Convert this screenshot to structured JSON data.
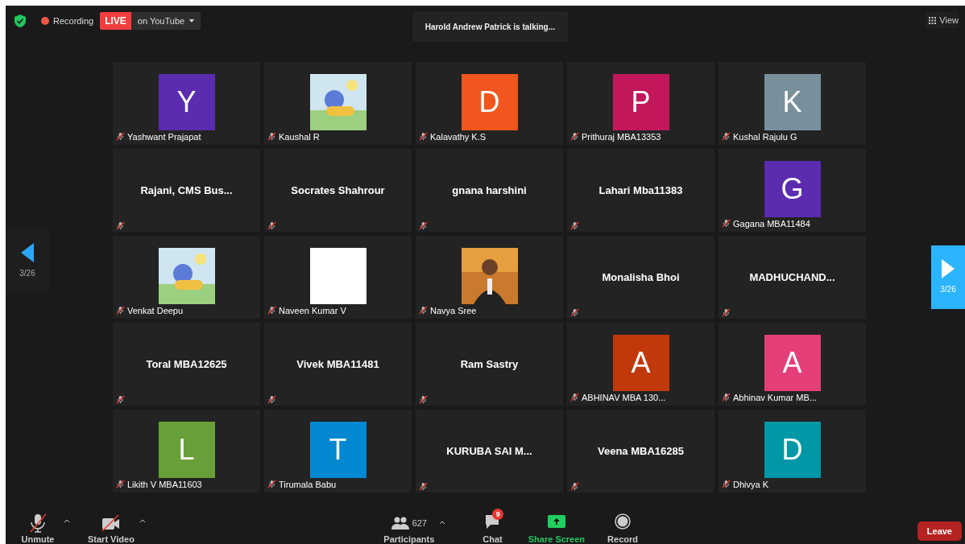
{
  "top_bar": {
    "recording_label": "Recording",
    "live_badge": "LIVE",
    "stream_target": "on YouTube",
    "talking": "Harold Andrew Patrick is talking...",
    "view_button": "View"
  },
  "pager": {
    "left": "3/26",
    "right": "3/26"
  },
  "tiles": [
    {
      "kind": "avatar",
      "letter": "Y",
      "color": "#5b2bb0",
      "name": "Yashwant Prajapat"
    },
    {
      "kind": "picture",
      "name": "Kaushal R"
    },
    {
      "kind": "avatar",
      "letter": "D",
      "color": "#f0561d",
      "name": "Kalavathy K.S"
    },
    {
      "kind": "avatar",
      "letter": "P",
      "color": "#c2185b",
      "name": "Prithuraj MBA13353"
    },
    {
      "kind": "avatar",
      "letter": "K",
      "color": "#78909c",
      "name": "Kushal Rajulu G"
    },
    {
      "kind": "label",
      "title": "Rajani,  CMS Bus..."
    },
    {
      "kind": "label",
      "title": "Socrates Shahrour"
    },
    {
      "kind": "label",
      "title": "gnana harshini"
    },
    {
      "kind": "label",
      "title": "Lahari Mba11383"
    },
    {
      "kind": "avatar",
      "letter": "G",
      "color": "#5b2bb0",
      "name": "Gagana MBA11484"
    },
    {
      "kind": "picture",
      "name": "Venkat Deepu"
    },
    {
      "kind": "blank",
      "name": "Naveen Kumar V"
    },
    {
      "kind": "picture",
      "name": "Navya Sree"
    },
    {
      "kind": "label",
      "title": "Monalisha Bhoi"
    },
    {
      "kind": "label",
      "title": "MADHUCHAND..."
    },
    {
      "kind": "label",
      "title": "Toral MBA12625"
    },
    {
      "kind": "label",
      "title": "Vivek MBA11481"
    },
    {
      "kind": "label",
      "title": "Ram Sastry"
    },
    {
      "kind": "avatar",
      "letter": "A",
      "color": "#c1390b",
      "name": "ABHINAV MBA 130..."
    },
    {
      "kind": "avatar",
      "letter": "A",
      "color": "#e53f7a",
      "name": "Abhinav Kumar MB..."
    },
    {
      "kind": "avatar",
      "letter": "L",
      "color": "#689f38",
      "name": "Likith V MBA11603"
    },
    {
      "kind": "avatar",
      "letter": "T",
      "color": "#0288d1",
      "name": "Tirumala Babu"
    },
    {
      "kind": "label",
      "title": "KURUBA SAI M..."
    },
    {
      "kind": "label",
      "title": "Veena MBA16285"
    },
    {
      "kind": "avatar",
      "letter": "D",
      "color": "#0097a7",
      "name": "Dhivya K"
    }
  ],
  "toolbar": {
    "unmute": "Unmute",
    "start_video": "Start Video",
    "participant_count": "627",
    "participants": "Participants",
    "chat_badge": "9",
    "chat": "Chat",
    "share_screen": "Share Screen",
    "record": "Record",
    "leave": "Leave"
  }
}
